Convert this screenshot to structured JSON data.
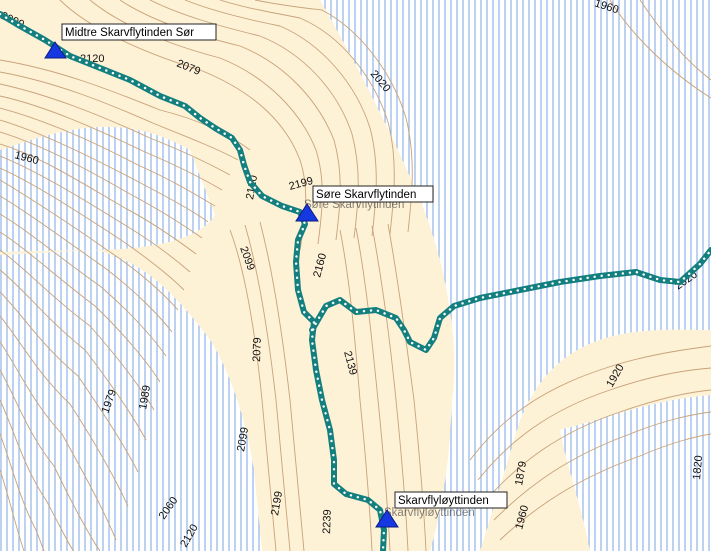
{
  "map": {
    "colors": {
      "land": "#fdf1d6",
      "contour": "#c9a27a",
      "glacier_hatch": "#8fb4e6",
      "track": "#137f7f",
      "track_dots": "#ffffff",
      "summit_marker": "#1638e0",
      "label_box": "#ffffff"
    },
    "contour_labels": [
      "2099",
      "2120",
      "2079",
      "2020",
      "1960",
      "1960",
      "2199",
      "2120",
      "2160",
      "2099",
      "2079",
      "2139",
      "1979",
      "1989",
      "2099",
      "2060",
      "2120",
      "2199",
      "2239",
      "1879",
      "1960",
      "1920",
      "1820",
      "2020"
    ],
    "peaks": [
      {
        "name": "Midtre Skarvflytinden Sør",
        "icon": "triangle-summit-icon"
      },
      {
        "name": "Søre Skarvflytinden",
        "ghost": "Søre Skarvflytinden",
        "icon": "triangle-summit-icon"
      },
      {
        "name": "Skarvflyløyttinden",
        "ghost": "Skarvflyløyttinden",
        "icon": "triangle-summit-icon"
      }
    ],
    "gps_track": {
      "style": "teal line with white dots"
    }
  }
}
